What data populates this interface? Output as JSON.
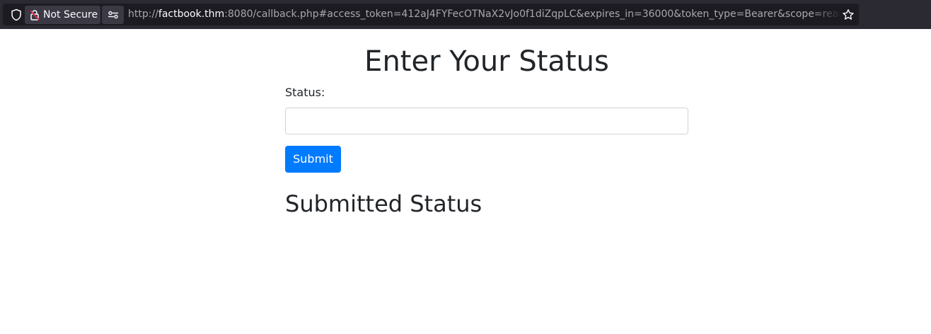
{
  "browser": {
    "security_label": "Not Secure",
    "url_prefix": "http://",
    "url_host": "factbook.thm",
    "url_rest": ":8080/callback.php#access_token=412aJ4FYFecOTNaX2vJo0f1diZqpLC&expires_in=36000&token_type=Bearer&scope=read+write&state"
  },
  "page": {
    "title": "Enter Your Status",
    "status_label": "Status:",
    "status_value": "",
    "submit_label": "Submit",
    "submitted_heading": "Submitted Status"
  },
  "colors": {
    "chrome_bg": "#2b2a33",
    "urlbar_bg": "#1c1b22",
    "button_blue": "#007bff"
  }
}
